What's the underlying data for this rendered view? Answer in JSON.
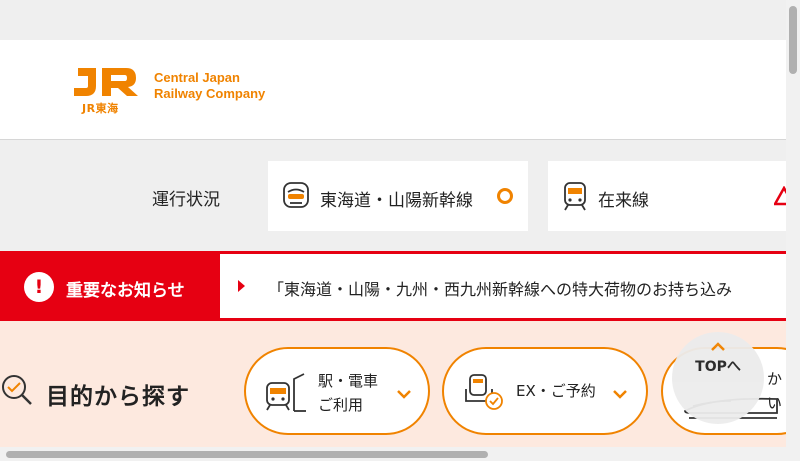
{
  "header": {
    "logo_mark": "JR",
    "logo_sub": "JR東海",
    "company_line1": "Central Japan",
    "company_line2": "Railway Company"
  },
  "status": {
    "label": "運行状況",
    "cards": [
      {
        "label": "東海道・山陽新幹線",
        "icon": "shinkansen-icon",
        "state": "normal"
      },
      {
        "label": "在来線",
        "icon": "train-icon",
        "state": "delay"
      }
    ]
  },
  "notice": {
    "title": "重要なお知らせ",
    "text": "「東海道・山陽・九州・西九州新幹線への特大荷物のお持ち込み"
  },
  "purpose": {
    "title": "目的から探す",
    "buttons": [
      {
        "line1": "駅・電車",
        "line2": "ご利用"
      },
      {
        "line1": "EX・ご予約"
      },
      {
        "line1": "か",
        "line2": "い"
      }
    ]
  },
  "totop": {
    "label": "TOPへ"
  },
  "colors": {
    "brand_orange": "#f08300",
    "alert_red": "#e60012",
    "peach_bg": "#fde9df"
  }
}
